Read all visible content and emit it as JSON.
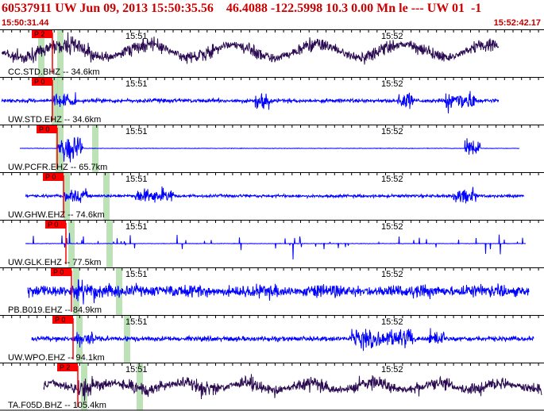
{
  "header": {
    "title": "60537911 UW Jun 09, 2013 15:50:35.56    46.4088 -122.5998 10.3 0.00 Mn le --- UW 01  -1",
    "start_time": "15:50:31.44",
    "end_time": "15:52:42.17"
  },
  "time_marks": [
    "15:51",
    "15:52"
  ],
  "colors": {
    "header_text": "#c00000",
    "title_text": "#cc0000",
    "trace_blue": "#0000ff",
    "trace_dark": "#2a0a50",
    "pick_flag": "#ff0000",
    "window_band": "#a8d8a0"
  },
  "traces": [
    {
      "label": "CC.STD.BHZ -- 34.6km",
      "pick": "P 2",
      "color": "dark"
    },
    {
      "label": "UW.STD.EHZ -- 34.6km",
      "pick": "P 0",
      "color": "blue"
    },
    {
      "label": "UW.PCFR.EHZ -- 65.7km",
      "pick": "P 0",
      "color": "blue"
    },
    {
      "label": "UW.GHW.EHZ -- 74.6km",
      "pick": "P 0",
      "color": "blue"
    },
    {
      "label": "UW.GLK.EHZ -- 77.5km",
      "pick": "P 0",
      "color": "blue"
    },
    {
      "label": "PB.B019.EHZ -- 84.9km",
      "pick": "P 0",
      "color": "blue"
    },
    {
      "label": "UW.WPO.EHZ -- 94.1km",
      "pick": "P 0",
      "color": "blue"
    },
    {
      "label": "TA.F05D.BHZ -- 105.4km",
      "pick": "P 2",
      "color": "dark"
    }
  ]
}
